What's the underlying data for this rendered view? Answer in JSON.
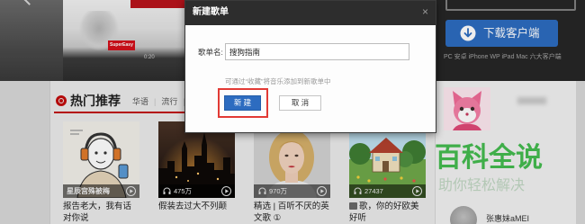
{
  "colors": {
    "accent_red": "#c20c0c",
    "button_blue": "#2d6cc0",
    "highlight_red": "#e23a35",
    "watermark_green": "#3fae49"
  },
  "banner": {
    "prev_icon": "chevron-left-icon",
    "tag": "SuperEasy",
    "time": "0:20"
  },
  "download": {
    "monitor_icon": "monitor-icon",
    "button_icon": "download-circle-icon",
    "button_label": "下载客户端",
    "platforms": "PC 安卓 iPhone WP iPad Mac 六大客户端"
  },
  "hot": {
    "icon": "target-ring-icon",
    "title": "热门推荐",
    "separator": "|",
    "tabs": [
      {
        "label": "华语"
      },
      {
        "label": "流行"
      }
    ],
    "cards": [
      {
        "count": "星辰宫殊被梅",
        "caption": "报告老大，我有话对你说",
        "play_icon": "play-circle-icon"
      },
      {
        "count": "475万",
        "caption": "假装去过大不列颠",
        "count_icon": "headphones-icon",
        "play_icon": "play-circle-icon"
      },
      {
        "count": "970万",
        "caption": "精选 | 百听不厌的英文歌 ①",
        "count_icon": "headphones-icon",
        "play_icon": "play-circle-icon"
      },
      {
        "count": "27437",
        "caption": "歌，你的好欧美好听",
        "count_icon": "headphones-icon",
        "play_icon": "play-circle-icon",
        "caption_icon": "tag-icon"
      }
    ]
  },
  "sidebar": {
    "artist_name": "张惠妹aMEI"
  },
  "dialog": {
    "title": "新建歌单",
    "close_glyph": "×",
    "field_label": "歌单名:",
    "field_value": "搜狗指南",
    "hint": "可通过“收藏”将音乐添加到新歌单中",
    "confirm_label": "新 建",
    "cancel_label": "取 消"
  },
  "watermark": {
    "title": "百科全说",
    "subtitle": "助你轻松解决"
  }
}
